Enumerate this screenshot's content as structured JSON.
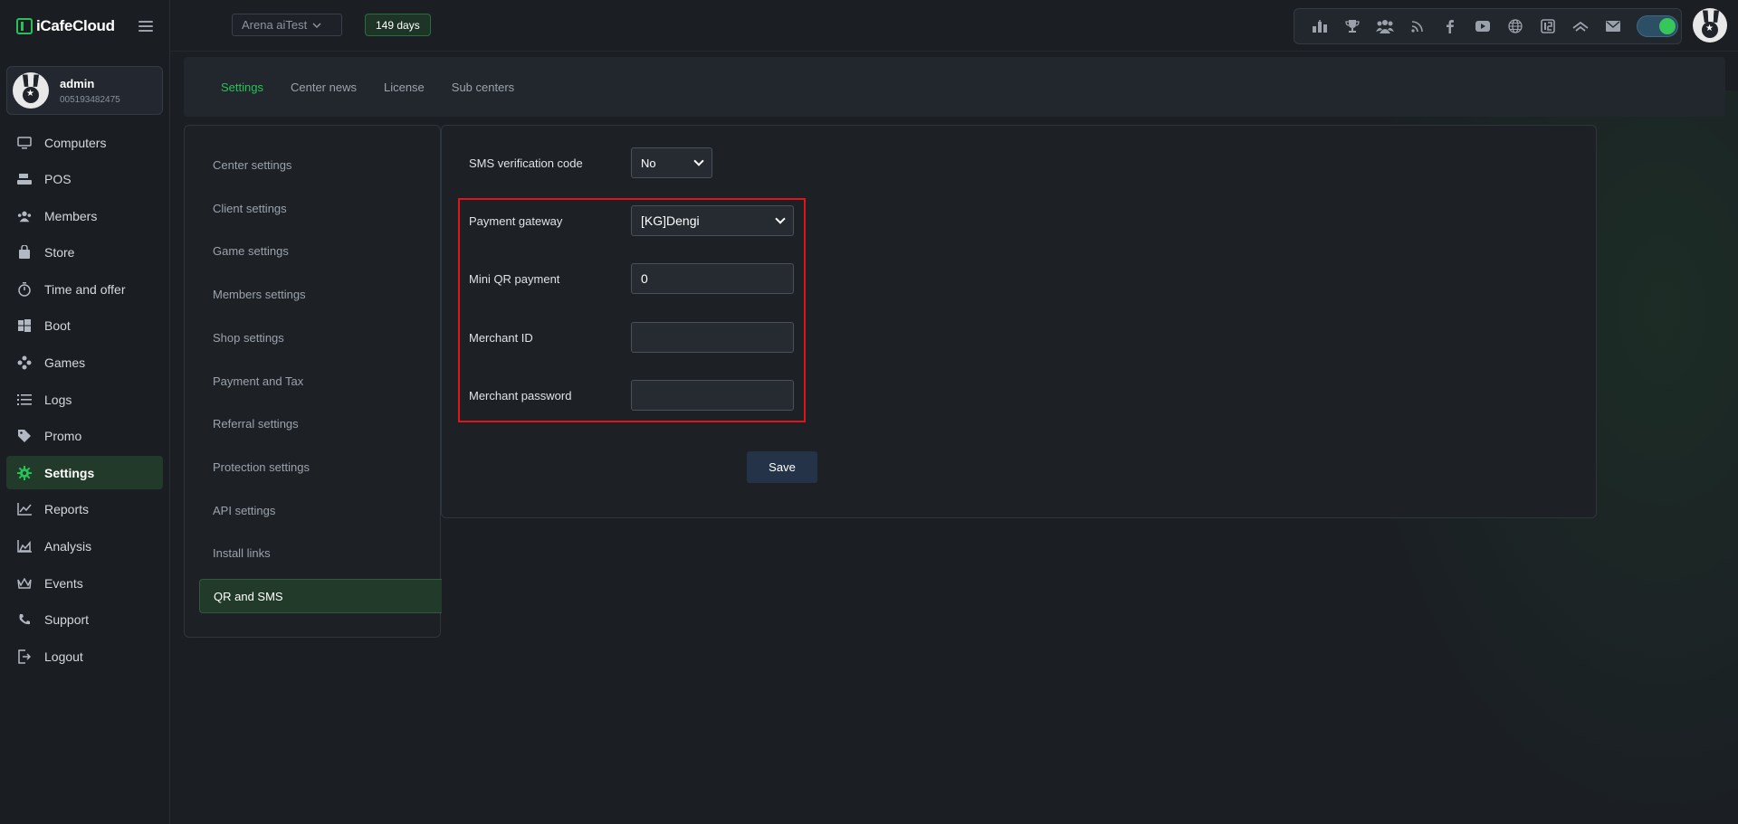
{
  "app": {
    "name": "iCafeCloud"
  },
  "user": {
    "name": "admin",
    "id": "005193482475"
  },
  "topbar": {
    "center_select": "Arena aiTest",
    "days_badge": "149 days",
    "tools": [
      "leaderboard-icon",
      "trophy-icon",
      "group-icon",
      "rss-icon",
      "facebook-icon",
      "youtube-icon",
      "globe-icon",
      "icafe-icon",
      "double-chevron-icon",
      "mail-icon"
    ]
  },
  "sidebar": {
    "items": [
      {
        "label": "Computers",
        "icon": "monitor-icon"
      },
      {
        "label": "POS",
        "icon": "pos-icon"
      },
      {
        "label": "Members",
        "icon": "members-icon"
      },
      {
        "label": "Store",
        "icon": "store-icon"
      },
      {
        "label": "Time and offer",
        "icon": "timer-icon"
      },
      {
        "label": "Boot",
        "icon": "windows-icon"
      },
      {
        "label": "Games",
        "icon": "gamepad-icon"
      },
      {
        "label": "Logs",
        "icon": "list-icon"
      },
      {
        "label": "Promo",
        "icon": "tag-icon"
      },
      {
        "label": "Settings",
        "icon": "gear-icon",
        "active": true
      },
      {
        "label": "Reports",
        "icon": "line-chart-icon"
      },
      {
        "label": "Analysis",
        "icon": "area-chart-icon"
      },
      {
        "label": "Events",
        "icon": "crown-icon"
      },
      {
        "label": "Support",
        "icon": "phone-icon"
      },
      {
        "label": "Logout",
        "icon": "logout-icon"
      }
    ]
  },
  "tabs": [
    {
      "label": "Settings",
      "active": true
    },
    {
      "label": "Center news"
    },
    {
      "label": "License"
    },
    {
      "label": "Sub centers"
    }
  ],
  "subnav": {
    "items": [
      {
        "label": "Center settings"
      },
      {
        "label": "Client settings"
      },
      {
        "label": "Game settings"
      },
      {
        "label": "Members settings"
      },
      {
        "label": "Shop settings"
      },
      {
        "label": "Payment and Tax"
      },
      {
        "label": "Referral settings"
      },
      {
        "label": "Protection settings"
      },
      {
        "label": "API settings"
      },
      {
        "label": "Install links"
      },
      {
        "label": "QR and SMS",
        "active": true
      }
    ]
  },
  "form": {
    "sms_label": "SMS verification code",
    "sms_value": "No",
    "gateway_label": "Payment gateway",
    "gateway_value": "[KG]Dengi",
    "mini_qr_label": "Mini QR payment",
    "mini_qr_value": "0",
    "merchant_id_label": "Merchant ID",
    "merchant_id_value": "",
    "merchant_password_label": "Merchant password",
    "merchant_password_value": "",
    "save_label": "Save"
  },
  "colors": {
    "accent": "#29c157",
    "highlight": "#e0141a",
    "active_bg": "#213a29"
  }
}
